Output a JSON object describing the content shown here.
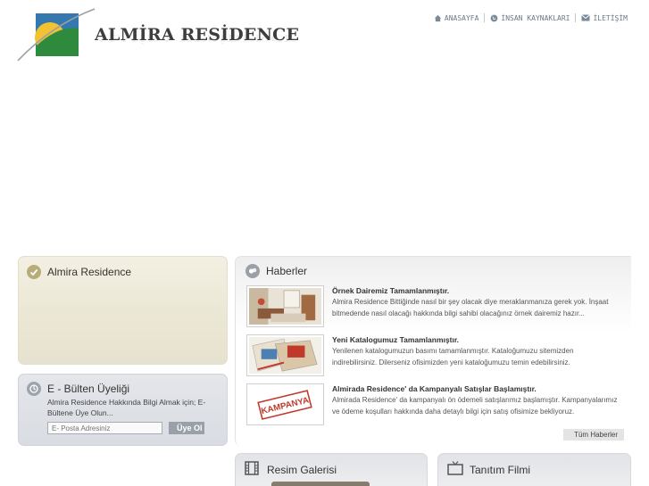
{
  "header": {
    "logo_text": "ALMİRA RESİDENCE",
    "logo_icon": "almira-logo-mark",
    "nav": [
      {
        "label": "ANASAYFA",
        "icon": "home-icon"
      },
      {
        "label": "İNSAN KAYNAKLARI",
        "icon": "globe-icon"
      },
      {
        "label": "İLETİŞİM",
        "icon": "mail-icon"
      }
    ]
  },
  "about_panel": {
    "title": "Almira Residence",
    "icon": "check-circle-icon"
  },
  "newsletter": {
    "title": "E - Bülten Üyeliği",
    "description": "Almira Residence Hakkında Bilgi Almak için; E-Bültene Üye Olun...",
    "placeholder": "E- Posta Adresiniz",
    "button_label": "Üye Ol",
    "icon": "newsletter-icon"
  },
  "news": {
    "title": "Haberler",
    "icon": "chat-bubbles-icon",
    "items": [
      {
        "headline": "Örnek Dairemiz Tamamlanmıştır.",
        "body": "Almira Residence Bittiğinde nasıl bir şey olacak diye meraklanmanıza gerek yok. İnşaat bitmedende nasıl olacağı hakkında bilgi sahibi olacağınız örnek dairemiz hazır...",
        "thumb": "interior-photo"
      },
      {
        "headline": "Yeni Katalogumuz Tamamlanmıştır.",
        "body": "Yenilenen katalogumuzun basımı tamamlanmıştır. Kataloğumuzu sitemizden indirebilirsiniz. Dilerseniz ofisimizden yeni kataloğumuzu temin edebilirsiniz.",
        "thumb": "catalog-photo"
      },
      {
        "headline": "Almirada Residence' da Kampanyalı Satışlar Başlamıştır.",
        "body": "Almirada Residence' da kampanyalı ön ödemeli satışlarımız başlamıştır. Kampanyalarımız ve ödeme koşulları hakkında daha detaylı bilgi için satış ofisimize bekliyoruz.",
        "thumb": "kampanya-stamp",
        "stamp_text": "KAMPANYA"
      }
    ],
    "all_news_label": "Tüm Haberler"
  },
  "gallery": {
    "title": "Resim Galerisi",
    "icon": "film-strip-icon"
  },
  "video": {
    "title": "Tanıtım Filmi",
    "icon": "tv-icon"
  },
  "colors": {
    "logo_green": "#2e8b3d",
    "logo_yellow": "#f2c230",
    "logo_blue": "#2a6fa8",
    "about_panel_bg": "#ebe7d5",
    "newsletter_bg": "#d9dce2"
  }
}
